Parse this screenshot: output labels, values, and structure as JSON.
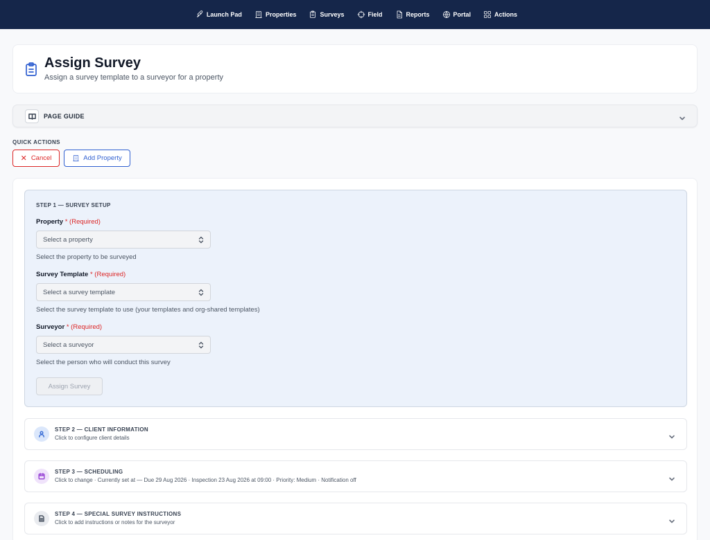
{
  "nav": {
    "items": [
      {
        "label": "Launch Pad",
        "icon": "rocket-icon"
      },
      {
        "label": "Properties",
        "icon": "building-icon"
      },
      {
        "label": "Surveys",
        "icon": "clipboard-icon"
      },
      {
        "label": "Field",
        "icon": "crosshair-icon"
      },
      {
        "label": "Reports",
        "icon": "document-icon"
      },
      {
        "label": "Portal",
        "icon": "globe-icon"
      },
      {
        "label": "Actions",
        "icon": "grid-icon"
      }
    ]
  },
  "header": {
    "title": "Assign Survey",
    "subtitle": "Assign a survey template to a surveyor for a property"
  },
  "guide": {
    "label": "PAGE GUIDE"
  },
  "quick_actions": {
    "label": "QUICK ACTIONS",
    "cancel_label": "Cancel",
    "add_property_label": "Add Property"
  },
  "step1": {
    "title": "STEP 1 — SURVEY SETUP",
    "property": {
      "label": "Property",
      "required": "* (Required)",
      "placeholder": "Select a property",
      "help": "Select the property to be surveyed"
    },
    "template": {
      "label": "Survey Template",
      "required": "* (Required)",
      "placeholder": "Select a survey template",
      "help": "Select the survey template to use (your templates and org-shared templates)"
    },
    "surveyor": {
      "label": "Surveyor",
      "required": "* (Required)",
      "placeholder": "Select a surveyor",
      "help": "Select the person who will conduct this survey"
    },
    "assign_label": "Assign Survey"
  },
  "steps": [
    {
      "title": "STEP 2 — CLIENT INFORMATION",
      "desc": "Click to configure client details",
      "icon": "person-icon",
      "color": "#3b6fd6",
      "bg": "#dbe7fb"
    },
    {
      "title": "STEP 3 — SCHEDULING",
      "desc": "Click to change · Currently set at — Due 29 Aug 2026 · Inspection 23 Aug 2026 at 09:00 · Priority: Medium · Notification off",
      "icon": "calendar-icon",
      "color": "#9b4ad6",
      "bg": "#f0e3fb"
    },
    {
      "title": "STEP 4 — SPECIAL SURVEY INSTRUCTIONS",
      "desc": "Click to add instructions or notes for the surveyor",
      "icon": "note-icon",
      "color": "#4b5563",
      "bg": "#e9ebef"
    }
  ]
}
